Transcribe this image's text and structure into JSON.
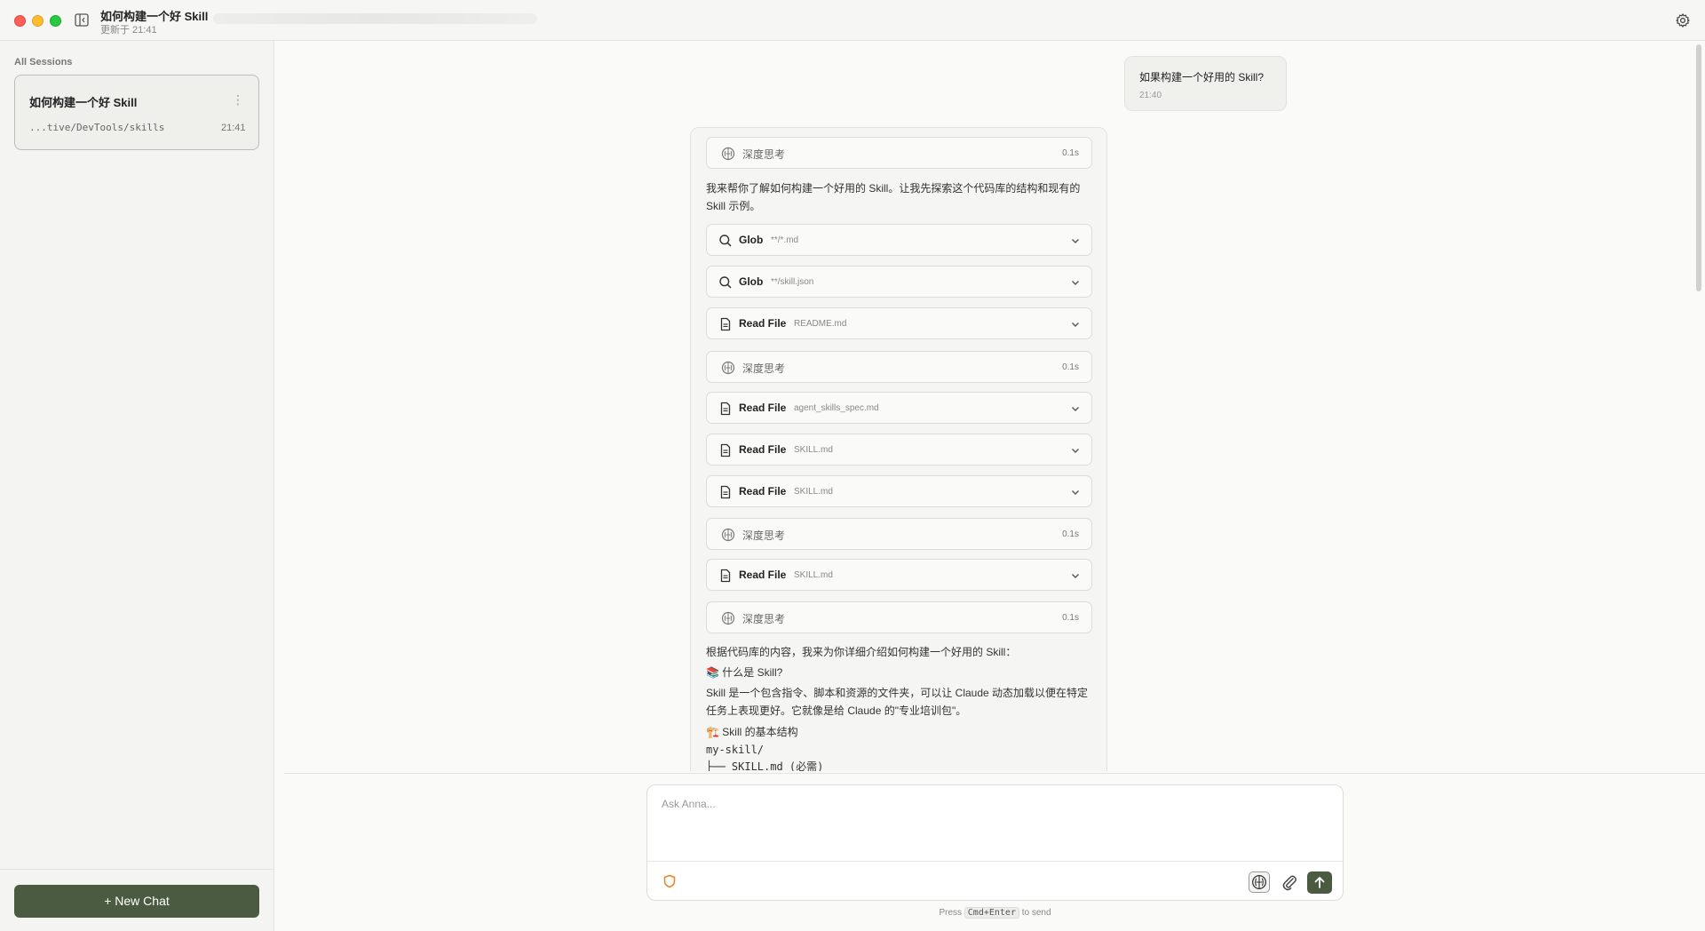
{
  "window": {
    "title": "如何构建一个好 Skill",
    "subtitle": "更新于 21:41"
  },
  "sidebar": {
    "section_label": "All Sessions",
    "sessions": [
      {
        "title": "如何构建一个好 Skill",
        "path": "...tive/DevTools/skills",
        "time": "21:41",
        "menu_glyph": "⋮"
      }
    ],
    "new_chat_label": "+ New Chat"
  },
  "conversation": {
    "user_message": {
      "text": "如果构建一个好用的 Skill?",
      "time": "21:40"
    },
    "assistant": {
      "intro": "我来帮你了解如何构建一个好用的 Skill。让我先探索这个代码库的结构和现有的 Skill 示例。",
      "steps": [
        {
          "kind": "think",
          "name": "深度思考",
          "duration": "0.1s",
          "icon": "brain-icon"
        },
        {
          "kind": "tool",
          "name": "Glob",
          "arg": "**/*.md",
          "icon": "search-icon"
        },
        {
          "kind": "tool",
          "name": "Glob",
          "arg": "**/skill.json",
          "icon": "search-icon"
        },
        {
          "kind": "tool",
          "name": "Read File",
          "arg": "README.md",
          "icon": "file-icon"
        },
        {
          "kind": "think",
          "name": "深度思考",
          "duration": "0.1s",
          "icon": "brain-icon"
        },
        {
          "kind": "tool",
          "name": "Read File",
          "arg": "agent_skills_spec.md",
          "icon": "file-icon"
        },
        {
          "kind": "tool",
          "name": "Read File",
          "arg": "SKILL.md",
          "icon": "file-icon"
        },
        {
          "kind": "tool",
          "name": "Read File",
          "arg": "SKILL.md",
          "icon": "file-icon"
        },
        {
          "kind": "think",
          "name": "深度思考",
          "duration": "0.1s",
          "icon": "brain-icon"
        },
        {
          "kind": "tool",
          "name": "Read File",
          "arg": "SKILL.md",
          "icon": "file-icon"
        },
        {
          "kind": "think",
          "name": "深度思考",
          "duration": "0.1s",
          "icon": "brain-icon"
        }
      ],
      "body": {
        "lead": "根据代码库的内容，我来为你详细介绍如何构建一个好用的 Skill：",
        "what_heading": "📚 什么是 Skill?",
        "what_text": "Skill 是一个包含指令、脚本和资源的文件夹，可以让 Claude 动态加载以便在特定任务上表现更好。它就像是给 Claude 的\"专业培训包\"。",
        "structure_heading": "🏗️ Skill 的基本结构",
        "code_line_1": "my-skill/",
        "code_line_2": "├── SKILL.md (必需)"
      }
    }
  },
  "composer": {
    "placeholder": "Ask Anna...",
    "hint_prefix": "Press",
    "hint_key": "Cmd+Enter",
    "hint_suffix": "to send"
  },
  "colors": {
    "accent": "#4a5b42",
    "shield": "#e8862b"
  }
}
